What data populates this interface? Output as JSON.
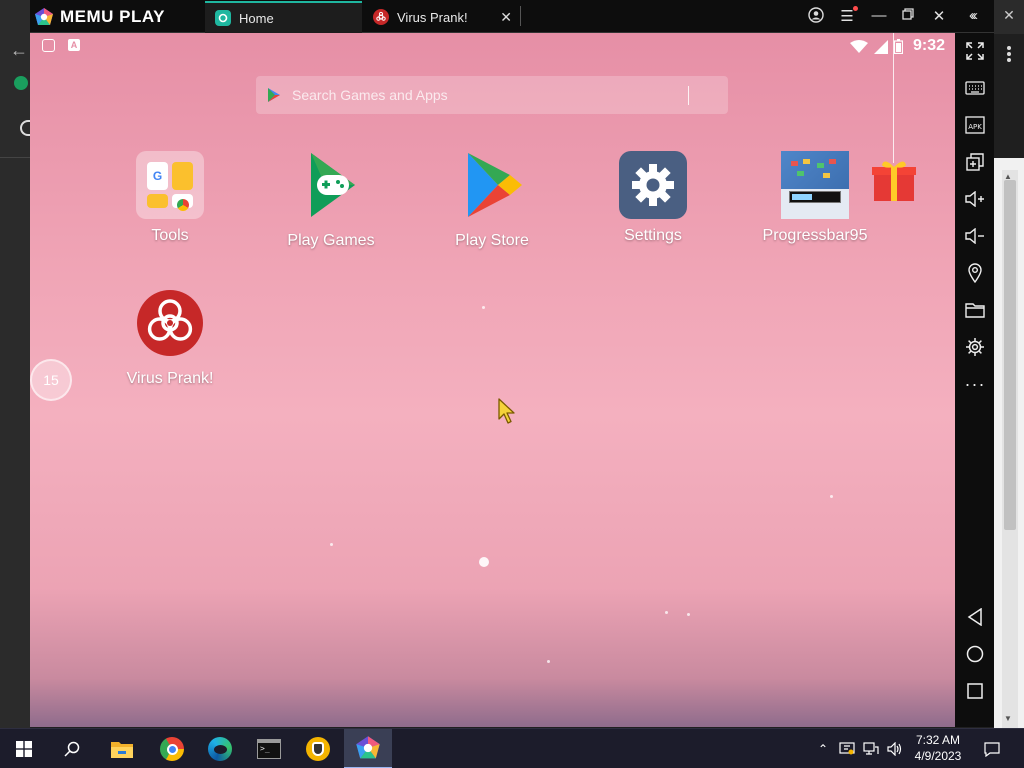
{
  "window": {
    "brand": "MEMU PLAY",
    "tabs": [
      {
        "label": "Home",
        "icon": "home-tab-icon",
        "active": true
      },
      {
        "label": "Virus Prank!",
        "icon": "biohazard-icon",
        "active": false
      }
    ],
    "controls": [
      "account-icon",
      "menu-icon",
      "minimize-icon",
      "restore-icon",
      "close-icon",
      "collapse-sidebar-icon"
    ]
  },
  "statusbar": {
    "time": "9:32",
    "icons": [
      "wifi-icon",
      "signal-icon",
      "battery-icon"
    ]
  },
  "search": {
    "placeholder": "Search Games and Apps"
  },
  "apps": [
    {
      "label": "Tools",
      "icon": "tools-folder-icon"
    },
    {
      "label": "Play Games",
      "icon": "play-games-icon"
    },
    {
      "label": "Play Store",
      "icon": "play-store-icon"
    },
    {
      "label": "Settings",
      "icon": "settings-gear-icon"
    },
    {
      "label": "Progressbar95",
      "icon": "progressbar95-icon"
    },
    {
      "label": "Virus Prank!",
      "icon": "biohazard-icon"
    }
  ],
  "timer_badge": "15",
  "sidebar_tools": [
    "fullscreen-icon",
    "keyboard-icon",
    "apk-icon",
    "multi-instance-icon",
    "volume-up-icon",
    "volume-down-icon",
    "location-icon",
    "folder-icon",
    "gear-icon",
    "more-icon"
  ],
  "android_nav": [
    "back-icon",
    "home-icon",
    "recents-icon"
  ],
  "taskbar": {
    "apps": [
      "windows-start-icon",
      "search-icon",
      "file-explorer-icon",
      "chrome-icon",
      "edge-icon",
      "terminal-icon",
      "vpn-shield-icon",
      "memu-icon"
    ],
    "clock_time": "7:32 AM",
    "clock_date": "4/9/2023"
  },
  "colors": {
    "accent": "#1fb7a0",
    "screen_pink": "#f0a5b6",
    "titlebar": "#0d0d0d",
    "taskbar": "#1c1c2b"
  }
}
